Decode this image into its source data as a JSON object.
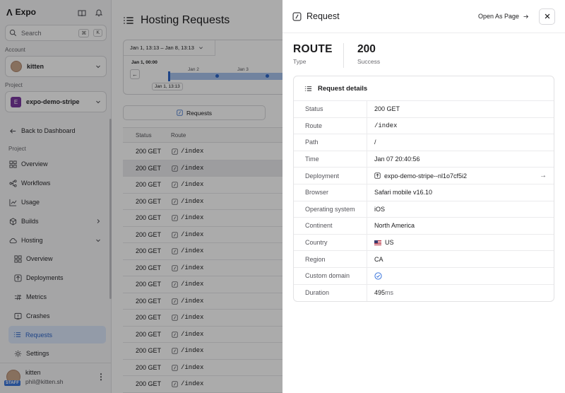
{
  "sidebar": {
    "brand": "Expo",
    "search_placeholder": "Search",
    "shortcut_keys": [
      "⌘",
      "K"
    ],
    "account_label": "Account",
    "account_name": "kitten",
    "project_label": "Project",
    "project_badge": "E",
    "project_name": "expo-demo-stripe",
    "back_label": "Back to Dashboard",
    "section_label": "Project",
    "nav": [
      {
        "label": "Overview",
        "icon": "grid-icon"
      },
      {
        "label": "Workflows",
        "icon": "workflow-icon"
      },
      {
        "label": "Usage",
        "icon": "chart-icon"
      },
      {
        "label": "Builds",
        "icon": "cube-icon"
      },
      {
        "label": "Hosting",
        "icon": "cloud-icon"
      }
    ],
    "hosting_sub": [
      {
        "label": "Overview"
      },
      {
        "label": "Deployments"
      },
      {
        "label": "Metrics"
      },
      {
        "label": "Crashes"
      },
      {
        "label": "Requests"
      },
      {
        "label": "Settings"
      }
    ],
    "user_name": "kitten",
    "user_email": "phil@kitten.sh",
    "user_badge": "STAFF",
    "accent_color": "#3b76dc"
  },
  "main": {
    "title": "Hosting Requests",
    "date_range": "Jan 1, 13:13 – Jan 8, 13:13",
    "timeline_start": "Jan 1, 00:00",
    "timeline_ticks": [
      "Jan 2",
      "Jan 3"
    ],
    "timeline_cursor": "Jan 1, 13:13",
    "requests_tab": "Requests",
    "columns": [
      "Status",
      "Route"
    ],
    "rows": [
      {
        "status": "200 GET",
        "route": "/index"
      },
      {
        "status": "200 GET",
        "route": "/index"
      },
      {
        "status": "200 GET",
        "route": "/index"
      },
      {
        "status": "200 GET",
        "route": "/index"
      },
      {
        "status": "200 GET",
        "route": "/index"
      },
      {
        "status": "200 GET",
        "route": "/index"
      },
      {
        "status": "200 GET",
        "route": "/index"
      },
      {
        "status": "200 GET",
        "route": "/index"
      },
      {
        "status": "200 GET",
        "route": "/index"
      },
      {
        "status": "200 GET",
        "route": "/index"
      },
      {
        "status": "200 GET",
        "route": "/index"
      },
      {
        "status": "200 GET",
        "route": "/index"
      },
      {
        "status": "200 GET",
        "route": "/index"
      },
      {
        "status": "200 GET",
        "route": "/index"
      },
      {
        "status": "200 GET",
        "route": "/index"
      },
      {
        "status": "200 GET",
        "route": "/index"
      }
    ]
  },
  "panel": {
    "title": "Request",
    "open_as_page": "Open As Page",
    "type_value": "ROUTE",
    "type_label": "Type",
    "status_value": "200",
    "status_label": "Success",
    "details_title": "Request details",
    "details": [
      {
        "key": "Status",
        "value": "200 GET"
      },
      {
        "key": "Route",
        "value": "/index"
      },
      {
        "key": "Path",
        "value": "/"
      },
      {
        "key": "Time",
        "value": "Jan 07 20:40:56"
      },
      {
        "key": "Deployment",
        "value": "expo-demo-stripe--nl1o7cf5i2"
      },
      {
        "key": "Browser",
        "value": "Safari mobile v16.10"
      },
      {
        "key": "Operating system",
        "value": "iOS"
      },
      {
        "key": "Continent",
        "value": "North America"
      },
      {
        "key": "Country",
        "value": "US"
      },
      {
        "key": "Region",
        "value": "CA"
      },
      {
        "key": "Custom domain",
        "value": ""
      },
      {
        "key": "Duration",
        "value": "495",
        "unit": "ms"
      }
    ]
  }
}
